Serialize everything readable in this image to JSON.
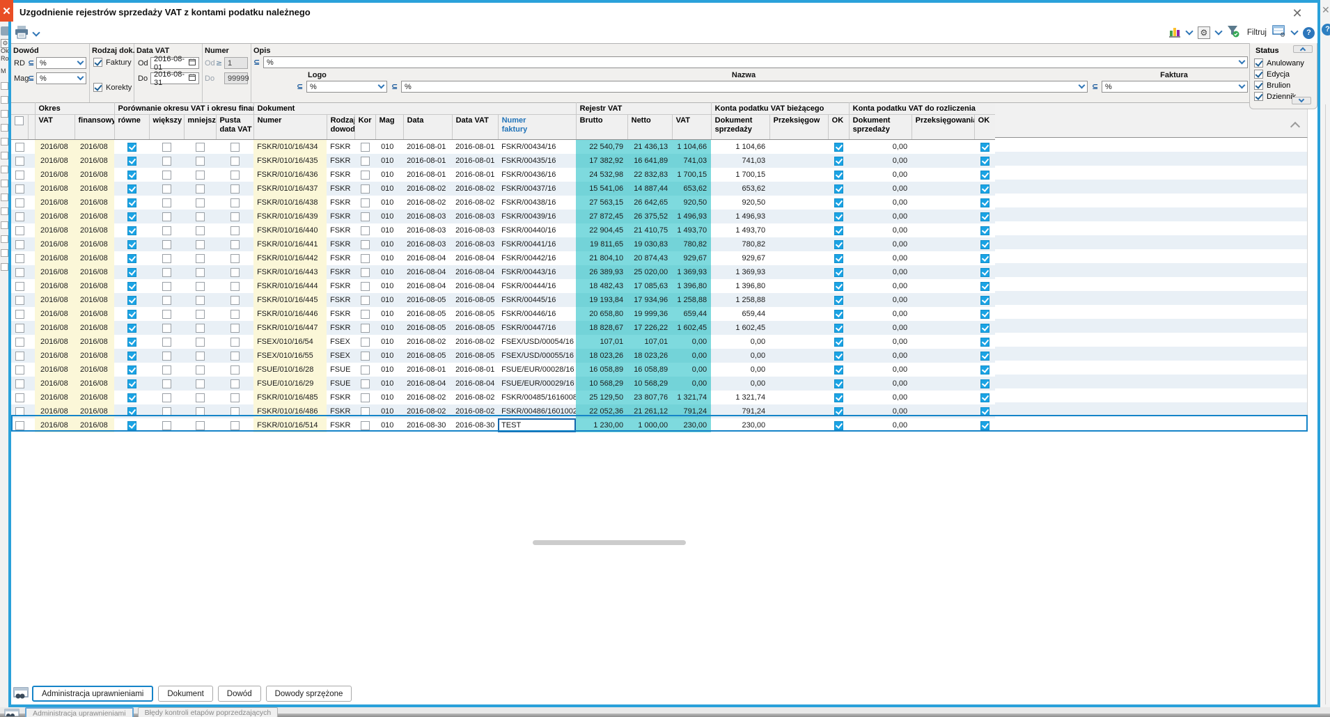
{
  "window": {
    "title": "Uzgodnienie rejestrów sprzedaży VAT z kontami podatku należnego",
    "close_glyph": "✕"
  },
  "ops": {
    "subset": "⊆",
    "gte": "≥"
  },
  "toolbar": {
    "filter_label": "Filtruj"
  },
  "filters": {
    "dowod": {
      "label": "Dowód",
      "rd_label": "RD",
      "rd_value": "%",
      "mag_label": "Mag",
      "mag_value": "%"
    },
    "rodzaj": {
      "label": "Rodzaj dok.",
      "opt1": "Faktury",
      "opt2": "Korekty",
      "opt1_checked": true,
      "opt2_checked": true
    },
    "data_vat": {
      "label": "Data VAT",
      "od_label": "Od",
      "od_value": "2016-08-01",
      "do_label": "Do",
      "do_value": "2016-08-31"
    },
    "numer": {
      "label": "Numer",
      "od_label": "Od",
      "od_value": "1",
      "do_label": "Do",
      "do_value": "99999"
    },
    "opis": {
      "label": "Opis",
      "value": "%"
    },
    "logo": {
      "label": "Logo",
      "value": "%"
    },
    "nazwa": {
      "label": "Nazwa",
      "value": "%"
    },
    "faktura": {
      "label": "Faktura",
      "value": "%"
    },
    "status": {
      "label": "Status",
      "options": [
        {
          "label": "Anulowany",
          "checked": true
        },
        {
          "label": "Edycja",
          "checked": true
        },
        {
          "label": "Brulion",
          "checked": true
        },
        {
          "label": "Dziennik",
          "checked": true
        }
      ]
    }
  },
  "table": {
    "groups": [
      "Okres",
      "Porównanie okresu VAT i okresu finansowego",
      "Dokument",
      "Rejestr VAT",
      "Konta podatku VAT bieżącego",
      "Konta podatku VAT do rozliczenia"
    ],
    "columns": {
      "okres_vat": "VAT",
      "okres_fin": "finansowy",
      "rowne": "równe",
      "wiekszy": "większy",
      "mniejszy": "mniejszy",
      "pusta_data_vat": "Pusta\ndata VAT",
      "numer": "Numer",
      "rodzaj": "Rodzaj\ndowodu",
      "kor": "Kor",
      "mag": "Mag",
      "data": "Data",
      "data_vat": "Data VAT",
      "numer_faktury": "Numer\nfaktury",
      "brutto": "Brutto",
      "netto": "Netto",
      "vat": "VAT",
      "dok1": "Dokument\nsprzedaży",
      "przeks1": "Przeksięgow",
      "ok1": "OK",
      "dok2": "Dokument\nsprzedaży",
      "przeks2": "Przeksięgowania",
      "ok2": "OK"
    },
    "rows": [
      {
        "okres_vat": "2016/08",
        "okres_fin": "2016/08",
        "rowne": true,
        "wiekszy": false,
        "mniejszy": false,
        "pusta_data_vat": false,
        "numer": "FSKR/010/16/434",
        "rodzaj": "FSKR",
        "kor": false,
        "mag": "010",
        "data": "2016-08-01",
        "data_vat": "2016-08-01",
        "numer_faktury": "FSKR/00434/16",
        "brutto": "22 540,79",
        "netto": "21 436,13",
        "vat": "1 104,66",
        "dok1": "1 104,66",
        "przeks1": "",
        "ok1": true,
        "dok2": "0,00",
        "przeks2": "",
        "ok2": true
      },
      {
        "okres_vat": "2016/08",
        "okres_fin": "2016/08",
        "rowne": true,
        "wiekszy": false,
        "mniejszy": false,
        "pusta_data_vat": false,
        "numer": "FSKR/010/16/435",
        "rodzaj": "FSKR",
        "kor": false,
        "mag": "010",
        "data": "2016-08-01",
        "data_vat": "2016-08-01",
        "numer_faktury": "FSKR/00435/16",
        "brutto": "17 382,92",
        "netto": "16 641,89",
        "vat": "741,03",
        "dok1": "741,03",
        "przeks1": "",
        "ok1": true,
        "dok2": "0,00",
        "przeks2": "",
        "ok2": true
      },
      {
        "okres_vat": "2016/08",
        "okres_fin": "2016/08",
        "rowne": true,
        "wiekszy": false,
        "mniejszy": false,
        "pusta_data_vat": false,
        "numer": "FSKR/010/16/436",
        "rodzaj": "FSKR",
        "kor": false,
        "mag": "010",
        "data": "2016-08-01",
        "data_vat": "2016-08-01",
        "numer_faktury": "FSKR/00436/16",
        "brutto": "24 532,98",
        "netto": "22 832,83",
        "vat": "1 700,15",
        "dok1": "1 700,15",
        "przeks1": "",
        "ok1": true,
        "dok2": "0,00",
        "przeks2": "",
        "ok2": true
      },
      {
        "okres_vat": "2016/08",
        "okres_fin": "2016/08",
        "rowne": true,
        "wiekszy": false,
        "mniejszy": false,
        "pusta_data_vat": false,
        "numer": "FSKR/010/16/437",
        "rodzaj": "FSKR",
        "kor": false,
        "mag": "010",
        "data": "2016-08-02",
        "data_vat": "2016-08-02",
        "numer_faktury": "FSKR/00437/16",
        "brutto": "15 541,06",
        "netto": "14 887,44",
        "vat": "653,62",
        "dok1": "653,62",
        "przeks1": "",
        "ok1": true,
        "dok2": "0,00",
        "przeks2": "",
        "ok2": true
      },
      {
        "okres_vat": "2016/08",
        "okres_fin": "2016/08",
        "rowne": true,
        "wiekszy": false,
        "mniejszy": false,
        "pusta_data_vat": false,
        "numer": "FSKR/010/16/438",
        "rodzaj": "FSKR",
        "kor": false,
        "mag": "010",
        "data": "2016-08-02",
        "data_vat": "2016-08-02",
        "numer_faktury": "FSKR/00438/16",
        "brutto": "27 563,15",
        "netto": "26 642,65",
        "vat": "920,50",
        "dok1": "920,50",
        "przeks1": "",
        "ok1": true,
        "dok2": "0,00",
        "przeks2": "",
        "ok2": true
      },
      {
        "okres_vat": "2016/08",
        "okres_fin": "2016/08",
        "rowne": true,
        "wiekszy": false,
        "mniejszy": false,
        "pusta_data_vat": false,
        "numer": "FSKR/010/16/439",
        "rodzaj": "FSKR",
        "kor": false,
        "mag": "010",
        "data": "2016-08-03",
        "data_vat": "2016-08-03",
        "numer_faktury": "FSKR/00439/16",
        "brutto": "27 872,45",
        "netto": "26 375,52",
        "vat": "1 496,93",
        "dok1": "1 496,93",
        "przeks1": "",
        "ok1": true,
        "dok2": "0,00",
        "przeks2": "",
        "ok2": true
      },
      {
        "okres_vat": "2016/08",
        "okres_fin": "2016/08",
        "rowne": true,
        "wiekszy": false,
        "mniejszy": false,
        "pusta_data_vat": false,
        "numer": "FSKR/010/16/440",
        "rodzaj": "FSKR",
        "kor": false,
        "mag": "010",
        "data": "2016-08-03",
        "data_vat": "2016-08-03",
        "numer_faktury": "FSKR/00440/16",
        "brutto": "22 904,45",
        "netto": "21 410,75",
        "vat": "1 493,70",
        "dok1": "1 493,70",
        "przeks1": "",
        "ok1": true,
        "dok2": "0,00",
        "przeks2": "",
        "ok2": true
      },
      {
        "okres_vat": "2016/08",
        "okres_fin": "2016/08",
        "rowne": true,
        "wiekszy": false,
        "mniejszy": false,
        "pusta_data_vat": false,
        "numer": "FSKR/010/16/441",
        "rodzaj": "FSKR",
        "kor": false,
        "mag": "010",
        "data": "2016-08-03",
        "data_vat": "2016-08-03",
        "numer_faktury": "FSKR/00441/16",
        "brutto": "19 811,65",
        "netto": "19 030,83",
        "vat": "780,82",
        "dok1": "780,82",
        "przeks1": "",
        "ok1": true,
        "dok2": "0,00",
        "przeks2": "",
        "ok2": true
      },
      {
        "okres_vat": "2016/08",
        "okres_fin": "2016/08",
        "rowne": true,
        "wiekszy": false,
        "mniejszy": false,
        "pusta_data_vat": false,
        "numer": "FSKR/010/16/442",
        "rodzaj": "FSKR",
        "kor": false,
        "mag": "010",
        "data": "2016-08-04",
        "data_vat": "2016-08-04",
        "numer_faktury": "FSKR/00442/16",
        "brutto": "21 804,10",
        "netto": "20 874,43",
        "vat": "929,67",
        "dok1": "929,67",
        "przeks1": "",
        "ok1": true,
        "dok2": "0,00",
        "przeks2": "",
        "ok2": true
      },
      {
        "okres_vat": "2016/08",
        "okres_fin": "2016/08",
        "rowne": true,
        "wiekszy": false,
        "mniejszy": false,
        "pusta_data_vat": false,
        "numer": "FSKR/010/16/443",
        "rodzaj": "FSKR",
        "kor": false,
        "mag": "010",
        "data": "2016-08-04",
        "data_vat": "2016-08-04",
        "numer_faktury": "FSKR/00443/16",
        "brutto": "26 389,93",
        "netto": "25 020,00",
        "vat": "1 369,93",
        "dok1": "1 369,93",
        "przeks1": "",
        "ok1": true,
        "dok2": "0,00",
        "przeks2": "",
        "ok2": true
      },
      {
        "okres_vat": "2016/08",
        "okres_fin": "2016/08",
        "rowne": true,
        "wiekszy": false,
        "mniejszy": false,
        "pusta_data_vat": false,
        "numer": "FSKR/010/16/444",
        "rodzaj": "FSKR",
        "kor": false,
        "mag": "010",
        "data": "2016-08-04",
        "data_vat": "2016-08-04",
        "numer_faktury": "FSKR/00444/16",
        "brutto": "18 482,43",
        "netto": "17 085,63",
        "vat": "1 396,80",
        "dok1": "1 396,80",
        "przeks1": "",
        "ok1": true,
        "dok2": "0,00",
        "przeks2": "",
        "ok2": true
      },
      {
        "okres_vat": "2016/08",
        "okres_fin": "2016/08",
        "rowne": true,
        "wiekszy": false,
        "mniejszy": false,
        "pusta_data_vat": false,
        "numer": "FSKR/010/16/445",
        "rodzaj": "FSKR",
        "kor": false,
        "mag": "010",
        "data": "2016-08-05",
        "data_vat": "2016-08-05",
        "numer_faktury": "FSKR/00445/16",
        "brutto": "19 193,84",
        "netto": "17 934,96",
        "vat": "1 258,88",
        "dok1": "1 258,88",
        "przeks1": "",
        "ok1": true,
        "dok2": "0,00",
        "przeks2": "",
        "ok2": true
      },
      {
        "okres_vat": "2016/08",
        "okres_fin": "2016/08",
        "rowne": true,
        "wiekszy": false,
        "mniejszy": false,
        "pusta_data_vat": false,
        "numer": "FSKR/010/16/446",
        "rodzaj": "FSKR",
        "kor": false,
        "mag": "010",
        "data": "2016-08-05",
        "data_vat": "2016-08-05",
        "numer_faktury": "FSKR/00446/16",
        "brutto": "20 658,80",
        "netto": "19 999,36",
        "vat": "659,44",
        "dok1": "659,44",
        "przeks1": "",
        "ok1": true,
        "dok2": "0,00",
        "przeks2": "",
        "ok2": true
      },
      {
        "okres_vat": "2016/08",
        "okres_fin": "2016/08",
        "rowne": true,
        "wiekszy": false,
        "mniejszy": false,
        "pusta_data_vat": false,
        "numer": "FSKR/010/16/447",
        "rodzaj": "FSKR",
        "kor": false,
        "mag": "010",
        "data": "2016-08-05",
        "data_vat": "2016-08-05",
        "numer_faktury": "FSKR/00447/16",
        "brutto": "18 828,67",
        "netto": "17 226,22",
        "vat": "1 602,45",
        "dok1": "1 602,45",
        "przeks1": "",
        "ok1": true,
        "dok2": "0,00",
        "przeks2": "",
        "ok2": true
      },
      {
        "okres_vat": "2016/08",
        "okres_fin": "2016/08",
        "rowne": true,
        "wiekszy": false,
        "mniejszy": false,
        "pusta_data_vat": false,
        "numer": "FSEX/010/16/54",
        "rodzaj": "FSEX",
        "kor": false,
        "mag": "010",
        "data": "2016-08-02",
        "data_vat": "2016-08-02",
        "numer_faktury": "FSEX/USD/00054/16",
        "brutto": "107,01",
        "netto": "107,01",
        "vat": "0,00",
        "dok1": "0,00",
        "przeks1": "",
        "ok1": true,
        "dok2": "0,00",
        "przeks2": "",
        "ok2": true
      },
      {
        "okres_vat": "2016/08",
        "okres_fin": "2016/08",
        "rowne": true,
        "wiekszy": false,
        "mniejszy": false,
        "pusta_data_vat": false,
        "numer": "FSEX/010/16/55",
        "rodzaj": "FSEX",
        "kor": false,
        "mag": "010",
        "data": "2016-08-05",
        "data_vat": "2016-08-05",
        "numer_faktury": "FSEX/USD/00055/16",
        "brutto": "18 023,26",
        "netto": "18 023,26",
        "vat": "0,00",
        "dok1": "0,00",
        "przeks1": "",
        "ok1": true,
        "dok2": "0,00",
        "przeks2": "",
        "ok2": true
      },
      {
        "okres_vat": "2016/08",
        "okres_fin": "2016/08",
        "rowne": true,
        "wiekszy": false,
        "mniejszy": false,
        "pusta_data_vat": false,
        "numer": "FSUE/010/16/28",
        "rodzaj": "FSUE",
        "kor": false,
        "mag": "010",
        "data": "2016-08-01",
        "data_vat": "2016-08-01",
        "numer_faktury": "FSUE/EUR/00028/16",
        "brutto": "16 058,89",
        "netto": "16 058,89",
        "vat": "0,00",
        "dok1": "0,00",
        "przeks1": "",
        "ok1": true,
        "dok2": "0,00",
        "przeks2": "",
        "ok2": true
      },
      {
        "okres_vat": "2016/08",
        "okres_fin": "2016/08",
        "rowne": true,
        "wiekszy": false,
        "mniejszy": false,
        "pusta_data_vat": false,
        "numer": "FSUE/010/16/29",
        "rodzaj": "FSUE",
        "kor": false,
        "mag": "010",
        "data": "2016-08-04",
        "data_vat": "2016-08-04",
        "numer_faktury": "FSUE/EUR/00029/16",
        "brutto": "10 568,29",
        "netto": "10 568,29",
        "vat": "0,00",
        "dok1": "0,00",
        "przeks1": "",
        "ok1": true,
        "dok2": "0,00",
        "przeks2": "",
        "ok2": true
      },
      {
        "okres_vat": "2016/08",
        "okres_fin": "2016/08",
        "rowne": true,
        "wiekszy": false,
        "mniejszy": false,
        "pusta_data_vat": false,
        "numer": "FSKR/010/16/485",
        "rodzaj": "FSKR",
        "kor": false,
        "mag": "010",
        "data": "2016-08-02",
        "data_vat": "2016-08-02",
        "numer_faktury": "FSKR/00485/1616008",
        "brutto": "25 129,50",
        "netto": "23 807,76",
        "vat": "1 321,74",
        "dok1": "1 321,74",
        "przeks1": "",
        "ok1": true,
        "dok2": "0,00",
        "przeks2": "",
        "ok2": true
      },
      {
        "okres_vat": "2016/08",
        "okres_fin": "2016/08",
        "rowne": true,
        "wiekszy": false,
        "mniejszy": false,
        "pusta_data_vat": false,
        "numer": "FSKR/010/16/486",
        "rodzaj": "FSKR",
        "kor": false,
        "mag": "010",
        "data": "2016-08-02",
        "data_vat": "2016-08-02",
        "numer_faktury": "FSKR/00486/1601002",
        "brutto": "22 052,36",
        "netto": "21 261,12",
        "vat": "791,24",
        "dok1": "791,24",
        "przeks1": "",
        "ok1": true,
        "dok2": "0,00",
        "przeks2": "",
        "ok2": true
      },
      {
        "okres_vat": "2016/08",
        "okres_fin": "2016/08",
        "rowne": true,
        "wiekszy": false,
        "mniejszy": false,
        "pusta_data_vat": false,
        "numer": "FSKR/010/16/514",
        "rodzaj": "FSKR",
        "kor": false,
        "mag": "010",
        "data": "2016-08-30",
        "data_vat": "2016-08-30",
        "numer_faktury": "TEST",
        "brutto": "1 230,00",
        "netto": "1 000,00",
        "vat": "230,00",
        "dok1": "230,00",
        "przeks1": "",
        "ok1": true,
        "dok2": "0,00",
        "przeks2": "",
        "ok2": true,
        "selected": true,
        "editing": true
      }
    ]
  },
  "footer": {
    "buttons": [
      {
        "label": "Administracja uprawnieniami",
        "active": true
      },
      {
        "label": "Dokument",
        "active": false
      },
      {
        "label": "Dowód",
        "active": false
      },
      {
        "label": "Dowody sprzężone",
        "active": false
      }
    ]
  },
  "background": {
    "tabs": [
      {
        "label": "Administracja uprawnieniami",
        "active": true
      },
      {
        "label": "Błędy kontroli etapów poprzedzających",
        "active": false
      }
    ],
    "left_fragments": [
      "Ok",
      "Ro",
      "M"
    ]
  },
  "colors": {
    "accent_blue": "#2aa1da",
    "check_blue": "#1aa3e4",
    "row_stripe": "#e9f0f6",
    "cell_yellow": "#fbf7d8",
    "cell_cyan": "#7edade",
    "selection_blue": "#1584c8"
  }
}
